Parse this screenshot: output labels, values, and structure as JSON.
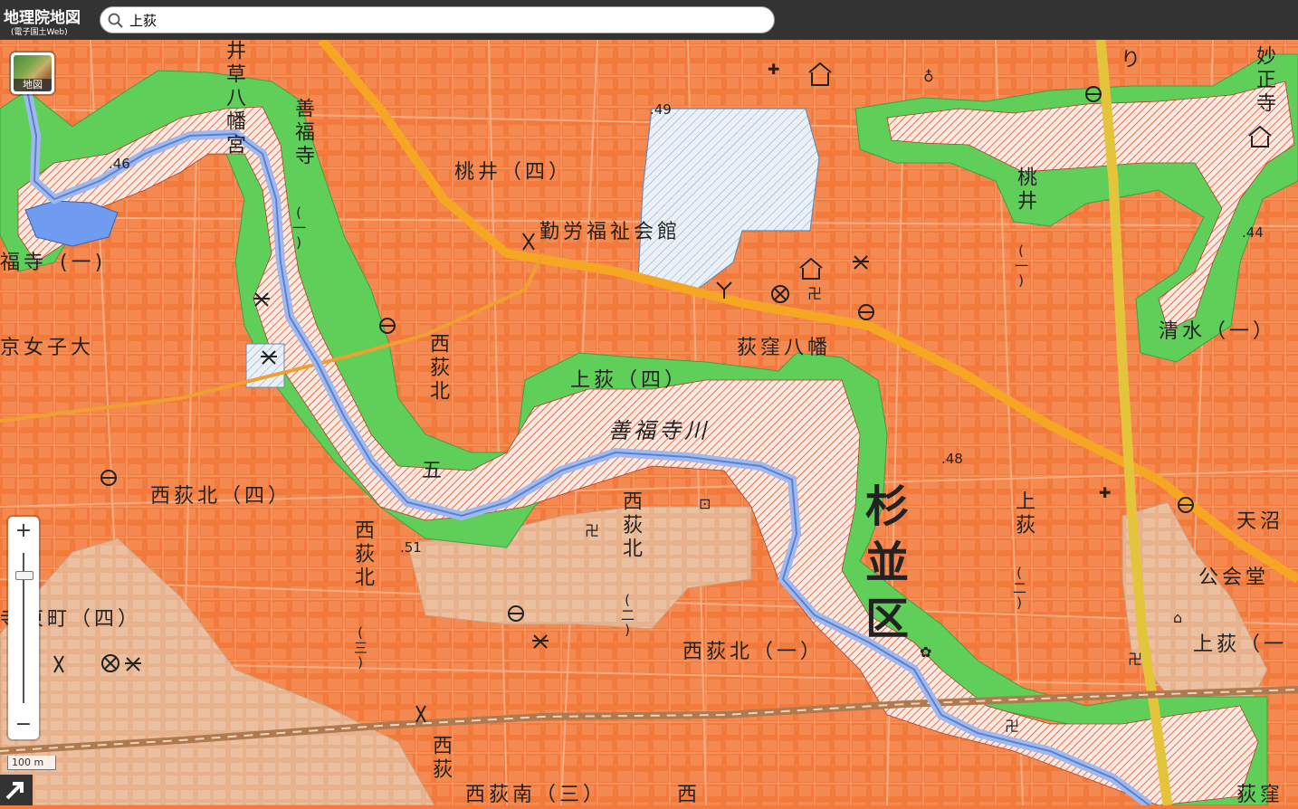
{
  "header": {
    "logo_main": "地理院地図",
    "logo_sub": "(電子国土Web)"
  },
  "search": {
    "value": "上荻",
    "placeholder": ""
  },
  "controls": {
    "layer_label": "地図",
    "zoom_in": "+",
    "zoom_out": "−",
    "scale": "100 m",
    "zoom_level_fraction": 0.88
  },
  "map_labels": {
    "izuka_hachiman": "井草八幡宮",
    "zenpukuji_v": "善福寺",
    "zenpukuji_v_paren": "(一)",
    "zenpukuji_left": "福寺",
    "zenpukuji_left_paren": "(一)",
    "momoi4": "桃井（四）",
    "kinro": "勤労福祉会館",
    "momoi1_v": "桃井",
    "momoi1_paren": "(一)",
    "myoshoji": "妙正寺",
    "shimizu1": "清水（一）",
    "tokyo_joshi": "京女子大",
    "nishiogi_kita_v": "西荻北",
    "kamiogi4": "上荻（四）",
    "ogikubo_hachiman": "荻窪八幡",
    "zenpukujigawa": "善福寺川",
    "go": "五",
    "nishiogikita4": "西荻北（四）",
    "nishiogikita_v2": "西荻北",
    "nishiogikita_v2_paren": "(二)",
    "nishiogikita_v3": "西荻北",
    "nishiogikita_v3_paren": "(三)",
    "nishiogikita1": "西荻北（一）",
    "suginami_v": "杉並区",
    "kamiogi2_v": "上荻",
    "kamiogi2_paren": "(二)",
    "kamiogi1": "上荻（一",
    "amanuma": "天沼",
    "kokaido": "公会堂",
    "higashicho4": "寺東町（四）",
    "nishiogiminami3": "西荻南（三）",
    "nishi_bottom": "西",
    "nishiogi_bottom_v": "西荻",
    "ogikubo_bottom": "荻窪",
    "elev_46": ".46",
    "elev_49": ".49",
    "elev_44": ".44",
    "elev_48": ".48",
    "elev_51": ".51",
    "ri": "り"
  },
  "colors": {
    "urban": "#f27a3c",
    "park_buffer": "#5fcf5a",
    "river": "#8aa8e6",
    "highway": "#f2a21a",
    "railway": "#7a5a3a",
    "hatched": "#fbe9e2",
    "blue_hatched": "#e6eef6",
    "beige_zone": "#e7b28f"
  }
}
